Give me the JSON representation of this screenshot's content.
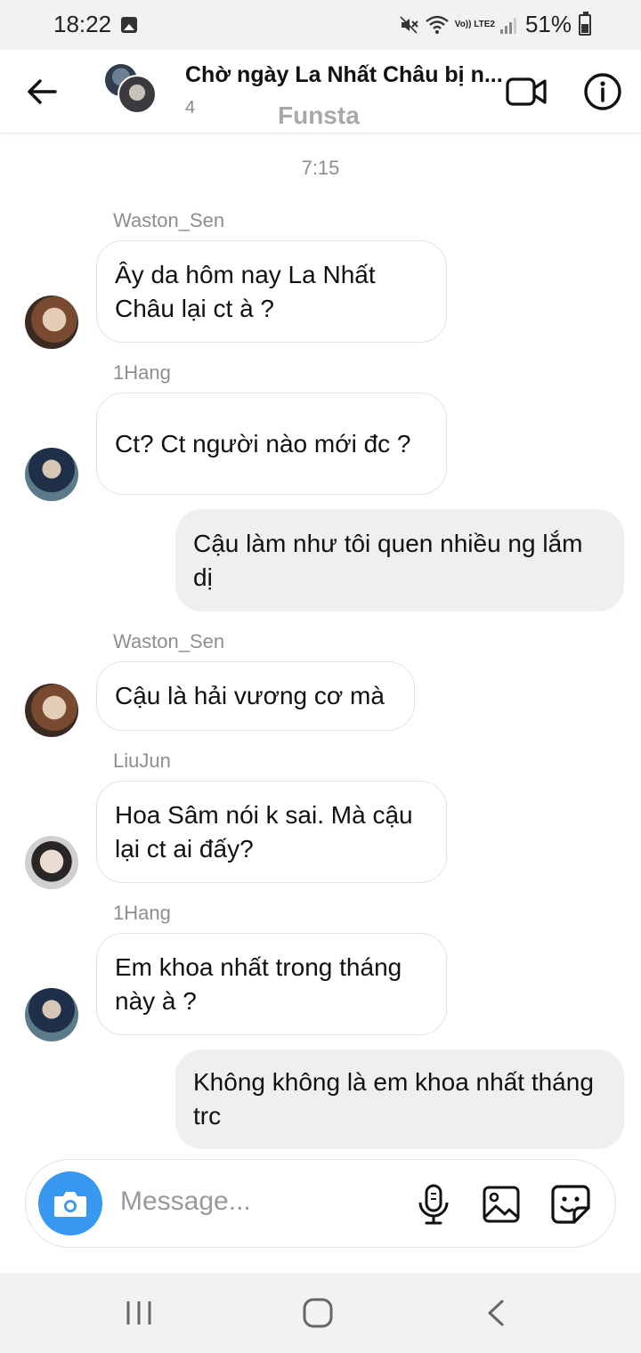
{
  "status_bar": {
    "time": "18:22",
    "network_label": "Vo)) LTE2",
    "battery_percent": "51%"
  },
  "header": {
    "title": "Chờ ngày La Nhất Châu bị n...",
    "member_count": "4",
    "watermark": "Funsta",
    "icons": {
      "back": "arrow-left-icon",
      "video": "video-camera-icon",
      "info": "info-circle-icon"
    }
  },
  "conversation": {
    "timestamp": "7:15",
    "messages": [
      {
        "direction": "incoming",
        "sender": "Waston_Sen",
        "text": "Ây da hôm nay La Nhất Châu lại ct à ?"
      },
      {
        "direction": "incoming",
        "sender": "1Hang",
        "text": "Ct? Ct người nào mới đc ?"
      },
      {
        "direction": "outgoing",
        "sender": "",
        "text": "Cậu làm như tôi quen nhiều ng lắm dị"
      },
      {
        "direction": "incoming",
        "sender": "Waston_Sen",
        "text": "Cậu là hải vương cơ mà"
      },
      {
        "direction": "incoming",
        "sender": "LiuJun",
        "text": "Hoa Sâm nói k sai. Mà cậu lại ct ai đấy?"
      },
      {
        "direction": "incoming",
        "sender": "1Hang",
        "text": "Em khoa nhất trong tháng này à ?"
      },
      {
        "direction": "outgoing",
        "sender": "",
        "text": "Không không là em khoa nhất tháng trc"
      }
    ]
  },
  "composer": {
    "placeholder": "Message...",
    "accent_color": "#3897f0",
    "icons": [
      "camera-icon",
      "microphone-icon",
      "image-icon",
      "sticker-icon"
    ]
  },
  "nav_bar": {
    "icons": [
      "recent-apps-icon",
      "home-icon",
      "back-icon"
    ]
  }
}
